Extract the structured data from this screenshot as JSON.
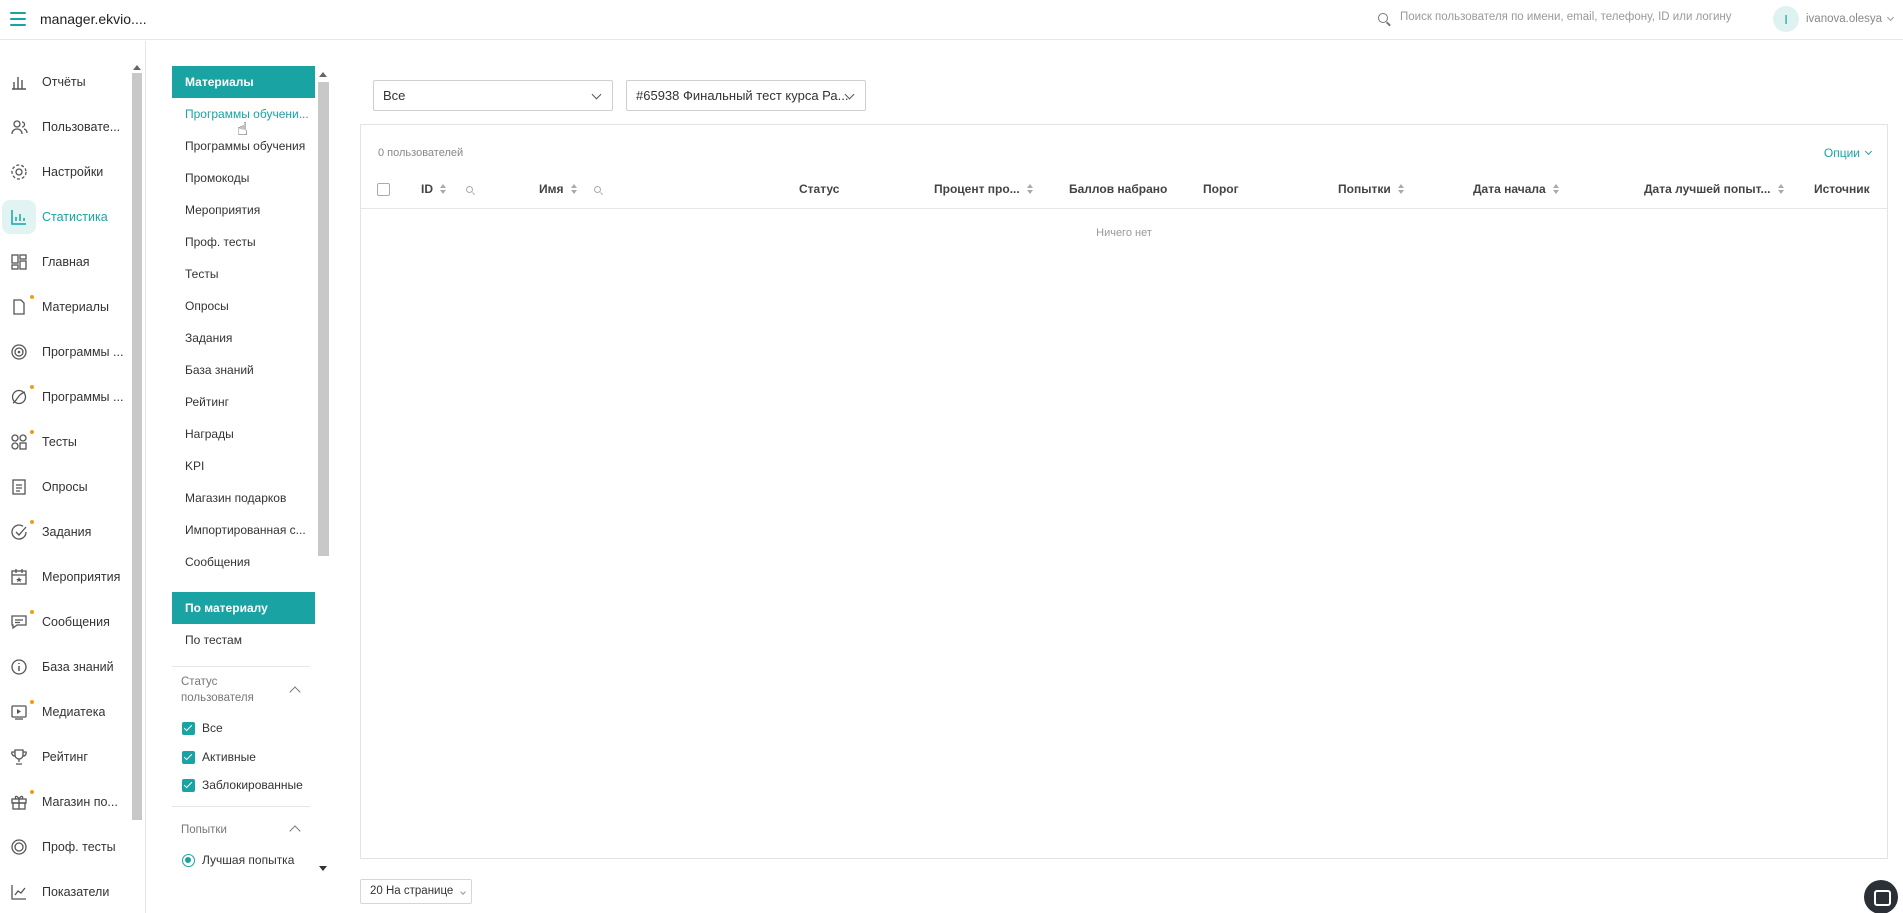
{
  "header": {
    "app_title": "manager.ekvio....",
    "search_placeholder": "Поиск пользователя по имени, email, телефону, ID или логину",
    "user_initial": "I",
    "user_name": "ivanova.olesya"
  },
  "nav": {
    "items": [
      {
        "label": "Отчёты",
        "icon": "reports-icon",
        "dot": false
      },
      {
        "label": "Пользовате...",
        "icon": "users-icon",
        "dot": false
      },
      {
        "label": "Настройки",
        "icon": "gear-icon",
        "dot": false
      },
      {
        "label": "Статистика",
        "icon": "statistics-icon",
        "dot": false,
        "active": true
      },
      {
        "label": "Главная",
        "icon": "dashboard-icon",
        "dot": false
      },
      {
        "label": "Материалы",
        "icon": "document-icon",
        "dot": true
      },
      {
        "label": "Программы ...",
        "icon": "programs-icon",
        "dot": false
      },
      {
        "label": "Программы ...",
        "icon": "trajectory-icon",
        "dot": true
      },
      {
        "label": "Тесты",
        "icon": "tests-icon",
        "dot": true
      },
      {
        "label": "Опросы",
        "icon": "survey-icon",
        "dot": false
      },
      {
        "label": "Задания",
        "icon": "tasks-icon",
        "dot": true
      },
      {
        "label": "Мероприятия",
        "icon": "calendar-icon",
        "dot": false
      },
      {
        "label": "Сообщения",
        "icon": "message-icon",
        "dot": true
      },
      {
        "label": "База знаний",
        "icon": "info-icon",
        "dot": false
      },
      {
        "label": "Медиатека",
        "icon": "media-icon",
        "dot": true
      },
      {
        "label": "Рейтинг",
        "icon": "trophy-icon",
        "dot": false
      },
      {
        "label": "Магазин по...",
        "icon": "gift-icon",
        "dot": true
      },
      {
        "label": "Проф. тесты",
        "icon": "prof-tests-icon",
        "dot": false
      },
      {
        "label": "Показатели",
        "icon": "chart-line-icon",
        "dot": false
      }
    ]
  },
  "submenu": {
    "materials_header": "Материалы",
    "items": [
      "Программы обучени...",
      "Программы обучения",
      "Промокоды",
      "Мероприятия",
      "Проф. тесты",
      "Тесты",
      "Опросы",
      "Задания",
      "База знаний",
      "Рейтинг",
      "Награды",
      "KPI",
      "Магазин подарков",
      "Импортированная с...",
      "Сообщения"
    ],
    "by_material_header": "По материалу",
    "by_tests": "По тестам"
  },
  "filters": {
    "status_title_line1": "Статус",
    "status_title_line2": "пользователя",
    "status_options": [
      "Все",
      "Активные",
      "Заблокированные"
    ],
    "attempts_title": "Попытки",
    "attempts_option": "Лучшая попытка"
  },
  "selects": {
    "scope_value": "Все",
    "test_value": "#65938 Финальный тест курса Ра..."
  },
  "table": {
    "count_text": "0 пользователей",
    "options_label": "Опции",
    "columns": [
      "ID",
      "Имя",
      "Статус",
      "Процент про...",
      "Баллов набрано",
      "Порог",
      "Попытки",
      "Дата начала",
      "Дата лучшей попыт...",
      "Источник"
    ],
    "empty_text": "Ничего нет"
  },
  "pager": {
    "per_page_label": "20 На странице"
  },
  "colors": {
    "accent": "#1aa3a3",
    "dot": "#f39c12"
  }
}
